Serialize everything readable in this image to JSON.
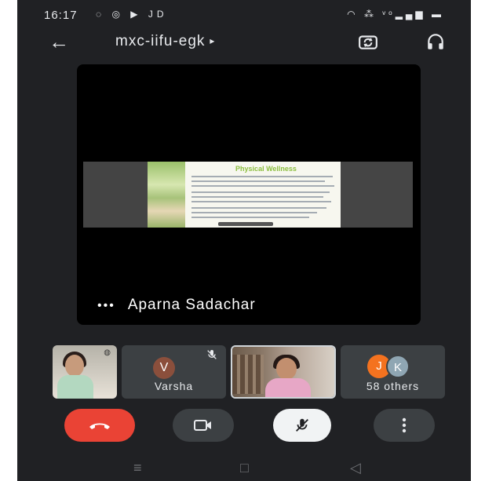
{
  "status_bar": {
    "time": "16:17",
    "left_icons": "◌ ◎ ▶ JD",
    "right_icons": "◠ ⁂ ᵛᵒ▂▄▆ ▬"
  },
  "app_bar": {
    "back_icon": "back-arrow",
    "meeting_code": "mxc-iifu-egk",
    "expand_glyph": "▸",
    "switch_camera_icon": "switch-camera",
    "audio_output_icon": "headphones"
  },
  "main_tile": {
    "presenter_name": "Aparna Sadachar",
    "more_glyph": "•••",
    "shared_slide_title": "Physical Wellness"
  },
  "participants": {
    "p2": {
      "initial": "V",
      "name": "Varsha",
      "avatar_color": "#8b4f3c"
    },
    "p4": {
      "initial1": "J",
      "initial2": "K",
      "others_label": "58 others",
      "color1": "#f4721f",
      "color2": "#8fa6b3"
    }
  },
  "controls": {
    "end_call_color": "#ea4335"
  },
  "nav_bar": {
    "menu_glyph": "≡",
    "home_glyph": "□",
    "back_glyph": "◁"
  }
}
